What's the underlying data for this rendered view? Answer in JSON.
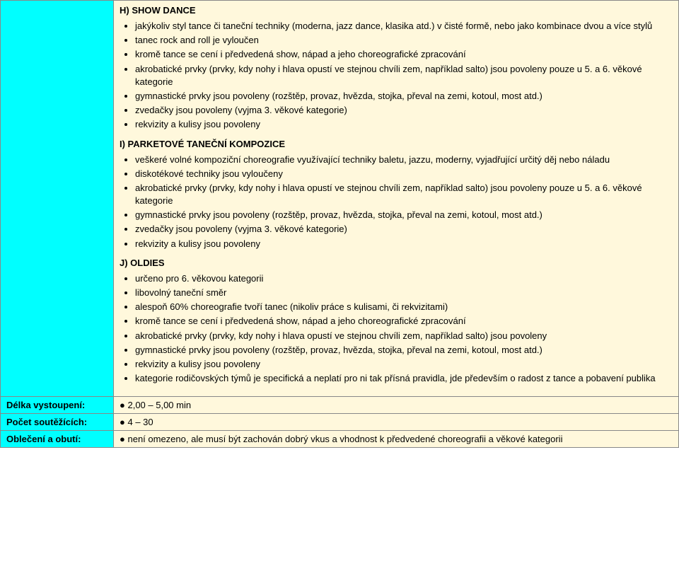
{
  "sections": {
    "H": {
      "title": "H) SHOW DANCE",
      "items": [
        "jakýkoliv styl tance či taneční techniky (moderna, jazz dance, klasika atd.) v čisté formě, nebo jako kombinace dvou a více stylů",
        "tanec rock and roll je vyloučen",
        "kromě tance se cení i předvedená show, nápad a jeho choreografické zpracování",
        "akrobatické prvky (prvky, kdy nohy i hlava opustí ve stejnou chvíli zem, například salto) jsou povoleny pouze u 5. a 6. věkové kategorie",
        "gymnastické prvky jsou povoleny (rozštěp, provaz, hvězda, stojka, převal na zemi, kotoul, most atd.)",
        "zvedačky jsou povoleny (vyjma 3. věkové kategorie)",
        "rekvizity a kulisy jsou povoleny"
      ]
    },
    "I": {
      "title": "I) PARKETOVÉ TANEČNÍ KOMPOZICE",
      "items": [
        "veškeré volné kompoziční choreografie využívající techniky baletu, jazzu, moderny, vyjadřující určitý děj nebo náladu",
        "diskotékové techniky jsou vyloučeny",
        "akrobatické prvky (prvky, kdy nohy i hlava opustí ve stejnou chvíli zem, například salto) jsou povoleny pouze u 5. a 6. věkové kategorie",
        "gymnastické prvky jsou povoleny (rozštěp, provaz, hvězda, stojka, převal na zemi, kotoul, most atd.)",
        "zvedačky jsou povoleny (vyjma 3. věkové kategorie)",
        "rekvizity a kulisy jsou povoleny"
      ]
    },
    "J": {
      "title": "J) OLDIES",
      "items": [
        "určeno pro 6. věkovou kategorii",
        "libovolný taneční směr",
        "alespoň 60% choreografie tvoří tanec (nikoliv práce s kulisami, či rekvizitami)",
        "kromě tance se cení i předvedená show, nápad a jeho choreografické zpracování",
        "akrobatické prvky (prvky, kdy nohy i hlava opustí ve stejnou chvíli zem, například salto) jsou povoleny",
        "gymnastické prvky jsou povoleny (rozštěp, provaz, hvězda, stojka, převal na zemi, kotoul, most atd.)",
        "rekvizity a kulisy jsou povoleny",
        "kategorie rodičovských týmů je specifická a neplatí pro ni tak přísná pravidla, jde především o radost z tance a pobavení publika"
      ]
    }
  },
  "rows": {
    "duration": {
      "label": "Délka vystoupení:",
      "value": "2,00 – 5,00 min"
    },
    "count": {
      "label": "Počet soutěžících:",
      "value": "4 – 30"
    },
    "clothing": {
      "label": "Oblečení a obutí:",
      "value": "není omezeno, ale musí být zachován dobrý vkus a vhodnost k předvedené choreografii a věkové kategorii"
    }
  },
  "bullet": "●"
}
